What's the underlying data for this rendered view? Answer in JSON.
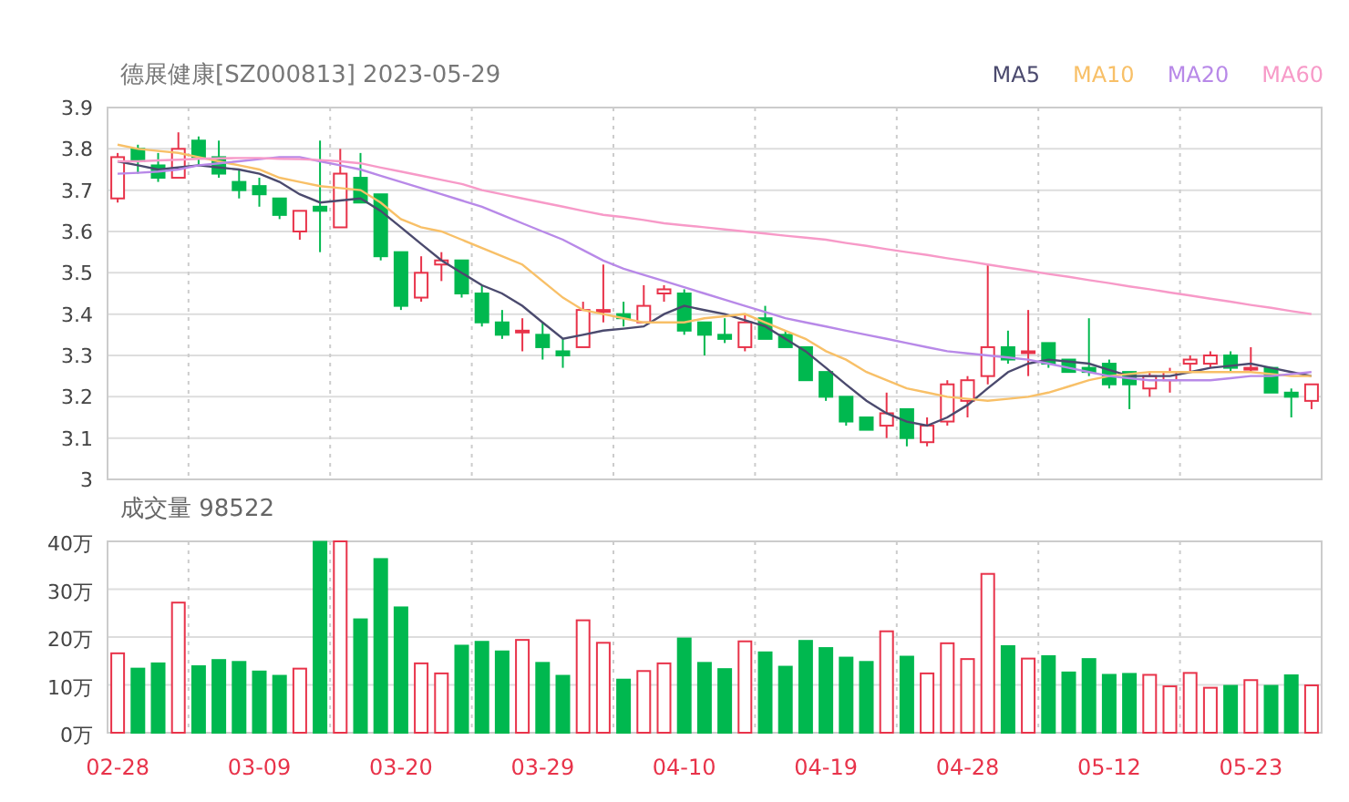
{
  "header": {
    "title": "德展健康[SZ000813] 2023-05-29"
  },
  "price_chart": {
    "chart_data": {
      "type": "candlestick",
      "grid": true,
      "categories": [
        null,
        null,
        null,
        null,
        null,
        null,
        null,
        null,
        null,
        null,
        null,
        null,
        null,
        null,
        null,
        null,
        null,
        null,
        null,
        null,
        null,
        null,
        null,
        null,
        null,
        null,
        null,
        null,
        null,
        null,
        null,
        null,
        null,
        null,
        null,
        null,
        null,
        null,
        null,
        null,
        null,
        null,
        null,
        null,
        null,
        null,
        null,
        null,
        null,
        null,
        null,
        null,
        null,
        null,
        null,
        null,
        null,
        null,
        null,
        null
      ],
      "ylim": [
        3,
        3.9
      ],
      "yticks": [
        3,
        3.1,
        3.2,
        3.3,
        3.4,
        3.5,
        3.6,
        3.7,
        3.8,
        3.9
      ],
      "series": [
        {
          "name": "MA5",
          "type": "line",
          "color": "#4b4a6e",
          "values": [
            3.77,
            3.76,
            3.75,
            3.755,
            3.76,
            3.755,
            3.75,
            3.74,
            3.72,
            3.69,
            3.67,
            3.675,
            3.68,
            3.65,
            3.61,
            3.57,
            3.53,
            3.5,
            3.47,
            3.45,
            3.42,
            3.38,
            3.34,
            3.35,
            3.36,
            3.365,
            3.37,
            3.4,
            3.42,
            3.41,
            3.4,
            3.385,
            3.37,
            3.34,
            3.31,
            3.27,
            3.23,
            3.19,
            3.16,
            3.14,
            3.13,
            3.15,
            3.18,
            3.22,
            3.26,
            3.28,
            3.29,
            3.285,
            3.28,
            3.265,
            3.25,
            3.25,
            3.25,
            3.26,
            3.27,
            3.275,
            3.28,
            3.27,
            3.26,
            3.25
          ]
        },
        {
          "name": "MA10",
          "type": "line",
          "color": "#f8c068",
          "values": [
            3.81,
            3.8,
            3.795,
            3.79,
            3.78,
            3.77,
            3.76,
            3.75,
            3.73,
            3.72,
            3.71,
            3.705,
            3.7,
            3.67,
            3.63,
            3.61,
            3.6,
            3.58,
            3.56,
            3.54,
            3.52,
            3.48,
            3.44,
            3.41,
            3.4,
            3.39,
            3.38,
            3.38,
            3.38,
            3.39,
            3.395,
            3.4,
            3.38,
            3.36,
            3.34,
            3.31,
            3.29,
            3.26,
            3.24,
            3.22,
            3.21,
            3.2,
            3.195,
            3.19,
            3.195,
            3.2,
            3.21,
            3.225,
            3.24,
            3.25,
            3.255,
            3.26,
            3.26,
            3.26,
            3.26,
            3.26,
            3.26,
            3.255,
            3.25,
            3.25
          ]
        },
        {
          "name": "MA20",
          "type": "line",
          "color": "#b889e8",
          "values": [
            3.74,
            3.742,
            3.745,
            3.75,
            3.76,
            3.765,
            3.77,
            3.775,
            3.78,
            3.78,
            3.77,
            3.76,
            3.75,
            3.735,
            3.72,
            3.705,
            3.69,
            3.675,
            3.66,
            3.64,
            3.62,
            3.6,
            3.58,
            3.555,
            3.53,
            3.51,
            3.495,
            3.48,
            3.465,
            3.45,
            3.435,
            3.42,
            3.405,
            3.39,
            3.38,
            3.37,
            3.36,
            3.35,
            3.34,
            3.33,
            3.32,
            3.31,
            3.305,
            3.3,
            3.295,
            3.29,
            3.28,
            3.27,
            3.26,
            3.25,
            3.245,
            3.24,
            3.24,
            3.24,
            3.24,
            3.245,
            3.25,
            3.25,
            3.255,
            3.26
          ]
        },
        {
          "name": "MA60",
          "type": "line",
          "color": "#f79ac8",
          "values": [
            3.77,
            3.77,
            3.772,
            3.774,
            3.776,
            3.777,
            3.778,
            3.778,
            3.776,
            3.775,
            3.773,
            3.77,
            3.765,
            3.755,
            3.745,
            3.735,
            3.725,
            3.715,
            3.7,
            3.69,
            3.68,
            3.67,
            3.66,
            3.65,
            3.64,
            3.635,
            3.628,
            3.62,
            3.615,
            3.61,
            3.605,
            3.6,
            3.595,
            3.59,
            3.585,
            3.58,
            3.572,
            3.565,
            3.557,
            3.55,
            3.543,
            3.535,
            3.528,
            3.52,
            3.512,
            3.505,
            3.497,
            3.49,
            3.482,
            3.475,
            3.467,
            3.46,
            3.452,
            3.445,
            3.437,
            3.43,
            3.422,
            3.415,
            3.407,
            3.4
          ]
        }
      ],
      "ohlc": [
        [
          3.68,
          3.79,
          3.67,
          3.78
        ],
        [
          3.8,
          3.81,
          3.74,
          3.77
        ],
        [
          3.76,
          3.79,
          3.72,
          3.73
        ],
        [
          3.73,
          3.84,
          3.73,
          3.8
        ],
        [
          3.82,
          3.83,
          3.76,
          3.78
        ],
        [
          3.78,
          3.82,
          3.73,
          3.74
        ],
        [
          3.72,
          3.75,
          3.68,
          3.7
        ],
        [
          3.71,
          3.73,
          3.66,
          3.69
        ],
        [
          3.68,
          3.68,
          3.63,
          3.64
        ],
        [
          3.6,
          3.65,
          3.58,
          3.65
        ],
        [
          3.66,
          3.82,
          3.55,
          3.65
        ],
        [
          3.61,
          3.8,
          3.61,
          3.74
        ],
        [
          3.73,
          3.79,
          3.67,
          3.67
        ],
        [
          3.69,
          3.69,
          3.53,
          3.54
        ],
        [
          3.55,
          3.55,
          3.41,
          3.42
        ],
        [
          3.44,
          3.54,
          3.43,
          3.5
        ],
        [
          3.52,
          3.55,
          3.48,
          3.53
        ],
        [
          3.53,
          3.53,
          3.44,
          3.45
        ],
        [
          3.45,
          3.47,
          3.37,
          3.38
        ],
        [
          3.38,
          3.41,
          3.34,
          3.35
        ],
        [
          3.36,
          3.39,
          3.31,
          3.36
        ],
        [
          3.35,
          3.38,
          3.29,
          3.32
        ],
        [
          3.31,
          3.34,
          3.27,
          3.3
        ],
        [
          3.32,
          3.43,
          3.32,
          3.41
        ],
        [
          3.41,
          3.52,
          3.38,
          3.41
        ],
        [
          3.4,
          3.43,
          3.37,
          3.39
        ],
        [
          3.38,
          3.47,
          3.38,
          3.42
        ],
        [
          3.45,
          3.47,
          3.43,
          3.46
        ],
        [
          3.45,
          3.46,
          3.35,
          3.36
        ],
        [
          3.38,
          3.38,
          3.3,
          3.35
        ],
        [
          3.35,
          3.39,
          3.33,
          3.34
        ],
        [
          3.32,
          3.4,
          3.31,
          3.38
        ],
        [
          3.39,
          3.42,
          3.34,
          3.34
        ],
        [
          3.35,
          3.36,
          3.32,
          3.32
        ],
        [
          3.32,
          3.32,
          3.24,
          3.24
        ],
        [
          3.26,
          3.26,
          3.19,
          3.2
        ],
        [
          3.2,
          3.2,
          3.13,
          3.14
        ],
        [
          3.15,
          3.15,
          3.12,
          3.12
        ],
        [
          3.13,
          3.21,
          3.1,
          3.16
        ],
        [
          3.17,
          3.17,
          3.08,
          3.1
        ],
        [
          3.09,
          3.15,
          3.08,
          3.13
        ],
        [
          3.14,
          3.24,
          3.13,
          3.23
        ],
        [
          3.19,
          3.25,
          3.15,
          3.24
        ],
        [
          3.25,
          3.52,
          3.23,
          3.32
        ],
        [
          3.32,
          3.36,
          3.28,
          3.29
        ],
        [
          3.31,
          3.41,
          3.25,
          3.31
        ],
        [
          3.33,
          3.33,
          3.27,
          3.28
        ],
        [
          3.29,
          3.29,
          3.26,
          3.26
        ],
        [
          3.27,
          3.39,
          3.25,
          3.26
        ],
        [
          3.28,
          3.29,
          3.22,
          3.23
        ],
        [
          3.26,
          3.26,
          3.17,
          3.23
        ],
        [
          3.22,
          3.26,
          3.2,
          3.25
        ],
        [
          3.24,
          3.27,
          3.21,
          3.26
        ],
        [
          3.28,
          3.3,
          3.26,
          3.29
        ],
        [
          3.28,
          3.31,
          3.27,
          3.3
        ],
        [
          3.3,
          3.31,
          3.26,
          3.27
        ],
        [
          3.27,
          3.32,
          3.26,
          3.27
        ],
        [
          3.27,
          3.27,
          3.21,
          3.21
        ],
        [
          3.21,
          3.22,
          3.15,
          3.2
        ],
        [
          3.19,
          3.23,
          3.17,
          3.23
        ]
      ]
    }
  },
  "volume_chart": {
    "title": "成交量 98522",
    "chart_data": {
      "type": "bar",
      "grid": true,
      "categories": [
        "02-28",
        null,
        null,
        null,
        null,
        null,
        null,
        "03-09",
        null,
        null,
        null,
        null,
        null,
        null,
        "03-20",
        null,
        null,
        null,
        null,
        null,
        null,
        "03-29",
        null,
        null,
        null,
        null,
        null,
        null,
        "04-10",
        null,
        null,
        null,
        null,
        null,
        null,
        "04-19",
        null,
        null,
        null,
        null,
        null,
        null,
        "04-28",
        null,
        null,
        null,
        null,
        null,
        null,
        "05-12",
        null,
        null,
        null,
        null,
        null,
        null,
        "05-23",
        null,
        null,
        null
      ],
      "ylim": [
        0,
        40
      ],
      "yticks": [
        {
          "value": 0,
          "label": "0万"
        },
        {
          "value": 10,
          "label": "10万"
        },
        {
          "value": 20,
          "label": "20万"
        },
        {
          "value": 30,
          "label": "30万"
        },
        {
          "value": 40,
          "label": "40万"
        }
      ],
      "series": [
        {
          "values": [
            16.6,
            13.4,
            14.5,
            27.2,
            13.9,
            15.2,
            14.8,
            12.8,
            11.9,
            13.4,
            39.9,
            40,
            23.7,
            36.3,
            26.2,
            14.5,
            12.4,
            18.2,
            19,
            17,
            19.4,
            14.6,
            11.9,
            23.5,
            18.8,
            11.1,
            12.9,
            14.5,
            19.7,
            14.6,
            13.3,
            19.1,
            16.8,
            13.8,
            19.2,
            17.7,
            15.7,
            14.8,
            21.2,
            15.9,
            12.4,
            18.7,
            15.4,
            33.2,
            18.1,
            15.5,
            16,
            12.6,
            15.4,
            12.1,
            12.3,
            12.1,
            9.7,
            12.5,
            9.4,
            9.8,
            11,
            9.8,
            12,
            9.9
          ]
        }
      ]
    }
  }
}
